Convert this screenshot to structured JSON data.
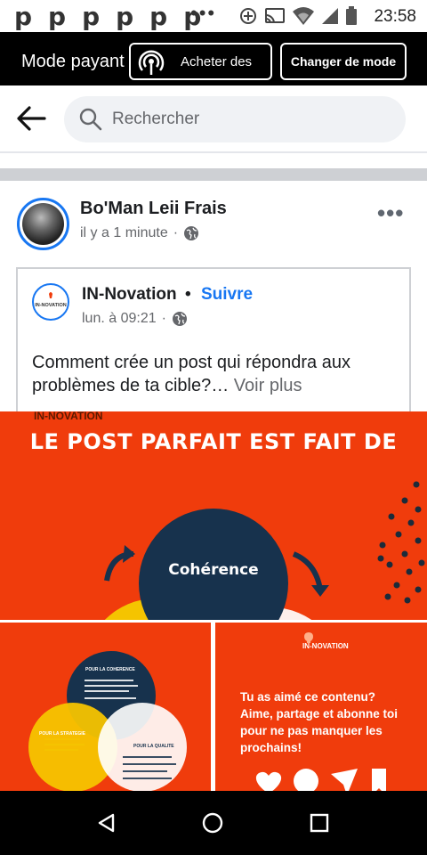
{
  "status_bar": {
    "notif_letters": "pppppp",
    "overflow": "•••",
    "time": "23:58"
  },
  "mode_banner": {
    "label": "Mode payant",
    "buy_button": "Acheter des",
    "change_button": "Changer de mode"
  },
  "search": {
    "placeholder": "Rechercher"
  },
  "post": {
    "author": "Bo'Man Leii Frais",
    "time": "il y a 1 minute",
    "separator": "·",
    "more": "•••",
    "shared": {
      "page_name": "IN-Novation",
      "bullet": "•",
      "follow": "Suivre",
      "time": "lun. à 09:21",
      "separator": "·",
      "avatar_text": "IN-NOVATION",
      "text": "Comment crée un post qui répondra aux problèmes de ta cible?…",
      "see_more": "Voir plus"
    }
  },
  "images": {
    "main": {
      "watermark": "IN-NOVATION",
      "headline": "LE POST PARFAIT EST FAIT DE",
      "circle_label": "Cohérence"
    },
    "bottom_left": {
      "top_label": "POUR LA COHERENCE",
      "left_label": "POUR LA STRATEGIE",
      "right_label": "POUR LA QUALITE"
    },
    "bottom_right": {
      "logo": "IN-NOVATION",
      "text": "Tu as aimé ce contenu? Aime, partage et abonne toi pour ne pas manquer les prochains!"
    }
  },
  "colors": {
    "brand_blue": "#1877f2",
    "image_orange": "#f03c0c",
    "navy": "#17324d",
    "yellow": "#f5c400"
  }
}
